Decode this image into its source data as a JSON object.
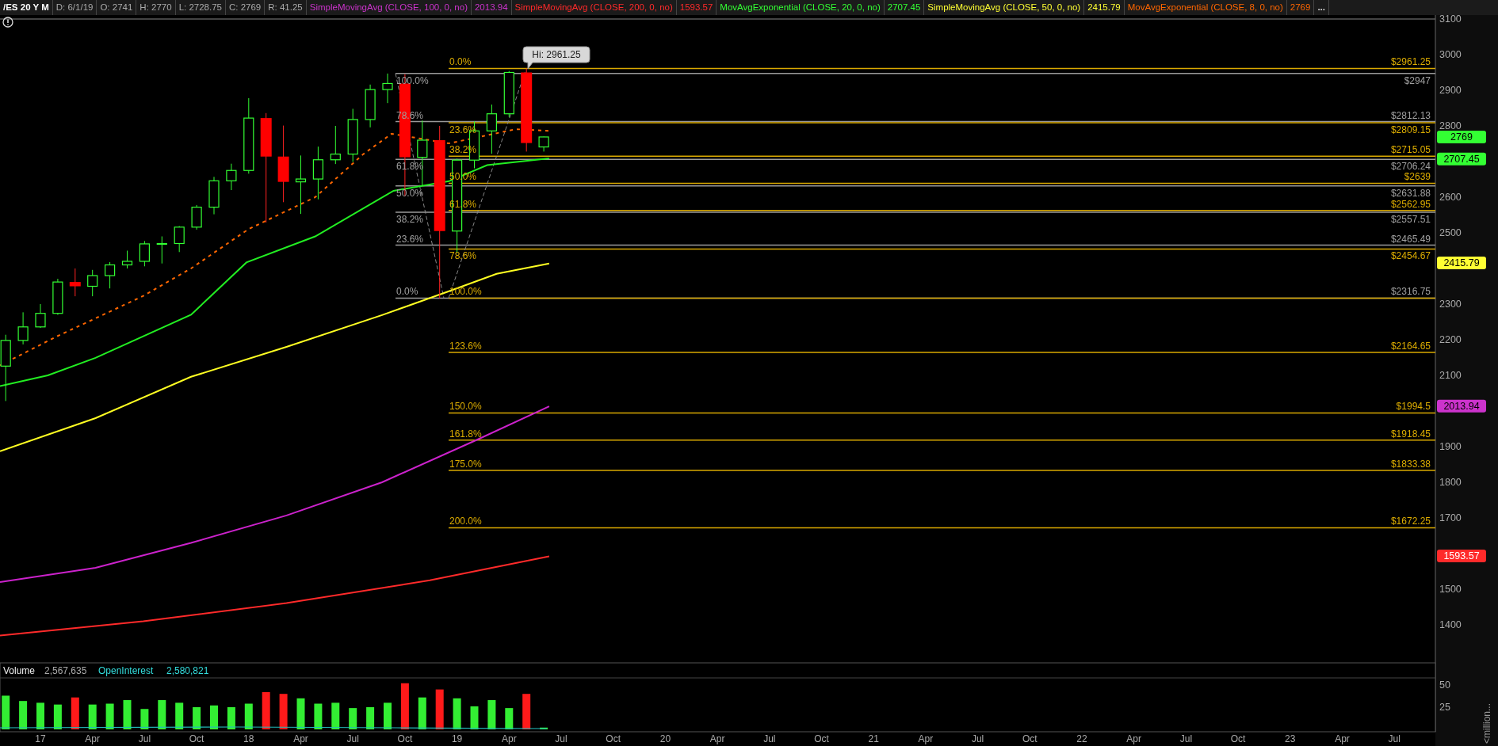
{
  "header": {
    "symbol": "/ES 20 Y M",
    "fields": [
      "D: 6/1/19",
      "O: 2741",
      "H: 2770",
      "L: 2728.75",
      "C: 2769",
      "R: 41.25"
    ],
    "studies": [
      {
        "name": "SimpleMovingAvg (CLOSE, 100, 0, no)",
        "value": "2013.94",
        "color": "#cc33cc"
      },
      {
        "name": "SimpleMovingAvg (CLOSE, 200, 0, no)",
        "value": "1593.57",
        "color": "#ff2a2a"
      },
      {
        "name": "MovAvgExponential (CLOSE, 20, 0, no)",
        "value": "2707.45",
        "color": "#33ff33"
      },
      {
        "name": "SimpleMovingAvg (CLOSE, 50, 0, no)",
        "value": "2415.79",
        "color": "#ffff33"
      },
      {
        "name": "MovAvgExponential (CLOSE, 8, 0, no)",
        "value": "2769",
        "color": "#ff6600"
      }
    ],
    "more": "..."
  },
  "chart": {
    "tooltip": "Hi: 2961.25",
    "price_ticks": [
      "3100",
      "3000",
      "2900",
      "2800",
      "2600",
      "2500",
      "2300",
      "2200",
      "2100",
      "1900",
      "1800",
      "1700",
      "1500",
      "1400"
    ],
    "badges": [
      {
        "value": "2769",
        "color": "#33ff33"
      },
      {
        "value": "2707.45",
        "color": "#33ff33"
      },
      {
        "value": "2415.79",
        "color": "#ffff33"
      },
      {
        "value": "2013.94",
        "color": "#cc33cc"
      },
      {
        "value": "1593.57",
        "color": "#ff2a2a"
      }
    ],
    "fib_retracement": [
      {
        "label": "100.0%",
        "price": "$2947"
      },
      {
        "label": "78.6%",
        "price": "$2812.13"
      },
      {
        "label": "61.8%",
        "price": "$2706.24"
      },
      {
        "label": "50.0%",
        "price": "$2631.88"
      },
      {
        "label": "38.2%",
        "price": "$2557.51"
      },
      {
        "label": "23.6%",
        "price": "$2465.49"
      },
      {
        "label": "0.0%",
        "price": "$2316.75"
      }
    ],
    "fib_extension": [
      {
        "label": "0.0%",
        "price": "$2961.25"
      },
      {
        "label": "23.6%",
        "price": "$2809.15"
      },
      {
        "label": "38.2%",
        "price": "$2715.05"
      },
      {
        "label": "50.0%",
        "price": "$2639"
      },
      {
        "label": "61.8%",
        "price": "$2562.95"
      },
      {
        "label": "78.6%",
        "price": "$2454.67"
      },
      {
        "label": "100.0%"
      },
      {
        "label": "123.6%",
        "price": "$2164.65"
      },
      {
        "label": "150.0%",
        "price": "$1994.5"
      },
      {
        "label": "161.8%",
        "price": "$1918.45"
      },
      {
        "label": "175.0%",
        "price": "$1833.38"
      },
      {
        "label": "200.0%",
        "price": "$1672.25"
      }
    ]
  },
  "volume": {
    "title": "Volume",
    "value": "2,567,635",
    "oi_title": "OpenInterest",
    "oi_value": "2,580,821",
    "ticks": [
      "50",
      "25"
    ],
    "unit": "<million..."
  },
  "x_axis": [
    "17",
    "Apr",
    "Jul",
    "Oct",
    "18",
    "Apr",
    "Jul",
    "Oct",
    "19",
    "Apr",
    "Jul",
    "Oct",
    "20",
    "Apr",
    "Jul",
    "Oct",
    "21",
    "Apr",
    "Jul",
    "Oct",
    "22",
    "Apr",
    "Jul",
    "Oct",
    "23",
    "Apr",
    "Jul"
  ]
}
